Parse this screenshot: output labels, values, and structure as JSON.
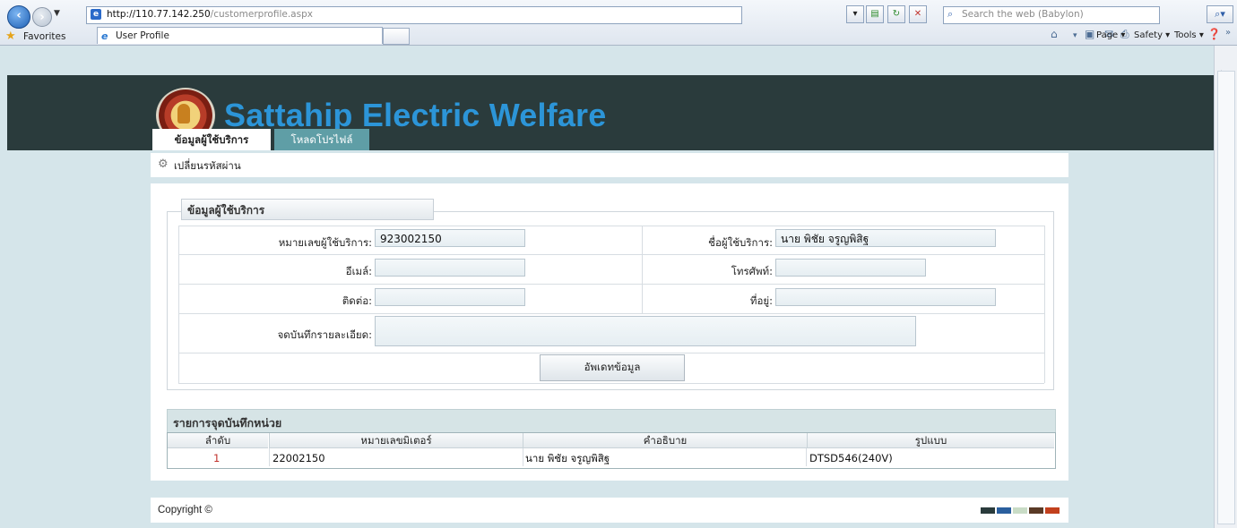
{
  "browser": {
    "address_host": "http://110.77.142.250",
    "address_path": "/customerprofile.aspx",
    "search_placeholder": "Search the web (Babylon)",
    "favorites_label": "Favorites",
    "tab_title": "User Profile",
    "tools": {
      "page": "Page ▾",
      "safety": "Safety ▾",
      "tools": "Tools ▾"
    }
  },
  "site": {
    "title": "Sattahip Electric Welfare",
    "nav_tabs": [
      "ข้อมูลผู้ใช้บริการ",
      "โหลดโปรไฟล์"
    ],
    "change_password": "เปลี่ยนรหัสผ่าน"
  },
  "form": {
    "legend": "ข้อมูลผู้ใช้บริการ",
    "customer_no_label": "หมายเลขผู้ใช้บริการ:",
    "customer_no_value": "923002150",
    "customer_name_label": "ชื่อผู้ใช้บริการ:",
    "customer_name_value": "นาย พิชัย จรูญพิสิฐ",
    "email_label": "อีเมล์:",
    "email_value": "",
    "phone_label": "โทรศัพท์:",
    "phone_value": "",
    "contact_label": "ติดต่อ:",
    "contact_value": "",
    "address_label": "ที่อยู่:",
    "address_value": "",
    "note_label": "จดบันทึกรายละเอียด:",
    "note_value": "",
    "update_button": "อัพเดทข้อมูล"
  },
  "meter_list": {
    "title": "รายการจุดบันทึกหน่วย",
    "columns": [
      "ลำดับ",
      "หมายเลขมิเตอร์",
      "คำอธิบาย",
      "รูปแบบ"
    ],
    "rows": [
      {
        "index": "1",
        "meter_no": "22002150",
        "description": "นาย พิชัย จรูญพิสิฐ",
        "model": "DTSD546(240V)"
      }
    ]
  },
  "footer": {
    "copyright": "Copyright ©",
    "swatches": [
      "#2a3b3c",
      "#2a5f9e",
      "#c9dcc6",
      "#5a3a26",
      "#c2401d"
    ]
  }
}
